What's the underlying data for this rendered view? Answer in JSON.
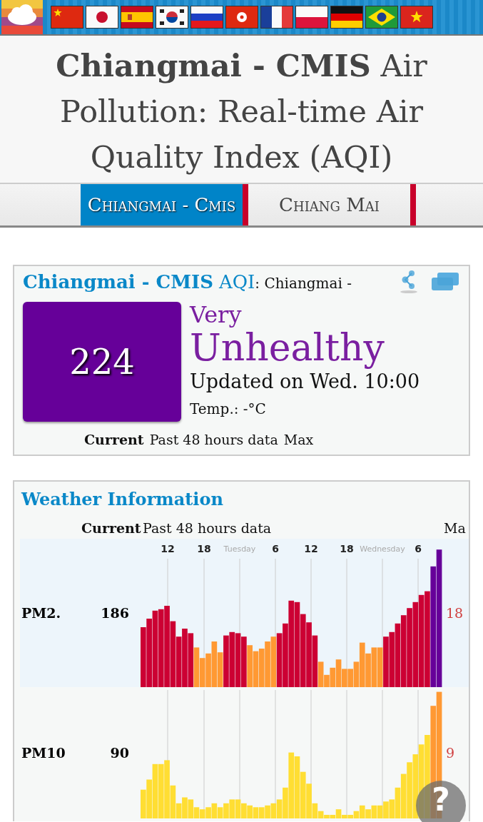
{
  "title": "**Chiangmai - CMIS** Air Pollution: Real-time Air Quality Index (AQI)",
  "tabs": [
    {
      "label": "Chiangmai - Cmis",
      "selected": true
    },
    {
      "label": "Chiang Mai",
      "selected": false
    }
  ],
  "aqi_card": {
    "station": "Chiangmai - CMIS",
    "label": "AQI",
    "suffix": ": Chiangmai -",
    "aqi": "224",
    "level_line1": "Very",
    "level_line2": "Unhealthy",
    "updated": "Updated on Wed. 10:00",
    "temperature": "Temp.: -°C",
    "columns": [
      "Current",
      "Past 48 hours data",
      "Max"
    ]
  },
  "weather": {
    "title": "Weather Information",
    "columns": [
      "Current",
      "Past 48 hours data",
      "Ma"
    ],
    "time_labels": [
      {
        "text": "12",
        "kind": "hour"
      },
      {
        "text": "18",
        "kind": "hour"
      },
      {
        "text": "Tuesday",
        "kind": "day"
      },
      {
        "text": "6",
        "kind": "hour"
      },
      {
        "text": "12",
        "kind": "hour"
      },
      {
        "text": "18",
        "kind": "hour"
      },
      {
        "text": "Wednesday",
        "kind": "day"
      },
      {
        "text": "6",
        "kind": "hour"
      }
    ],
    "rows": [
      {
        "name": "PM2.",
        "current": "186",
        "max": "18"
      },
      {
        "name": "PM10",
        "current": "90",
        "max": "9"
      }
    ]
  },
  "help_button": "?"
}
